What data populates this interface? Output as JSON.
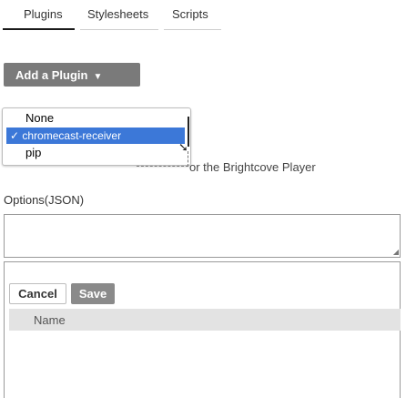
{
  "tabs": [
    "Plugins",
    "Stylesheets",
    "Scripts"
  ],
  "add_plugin": {
    "label": "Add a Plugin",
    "chevron": "▼"
  },
  "dropdown": {
    "options": [
      "None",
      "chromecast-receiver",
      "pip"
    ],
    "selected_prefix": "✓ ",
    "selected_color": "#3c78d8"
  },
  "hint_text": "or the Brightcove Player",
  "options_label": "Options(JSON)",
  "actions": {
    "cancel": "Cancel",
    "save": "Save"
  },
  "name_column": "Name"
}
